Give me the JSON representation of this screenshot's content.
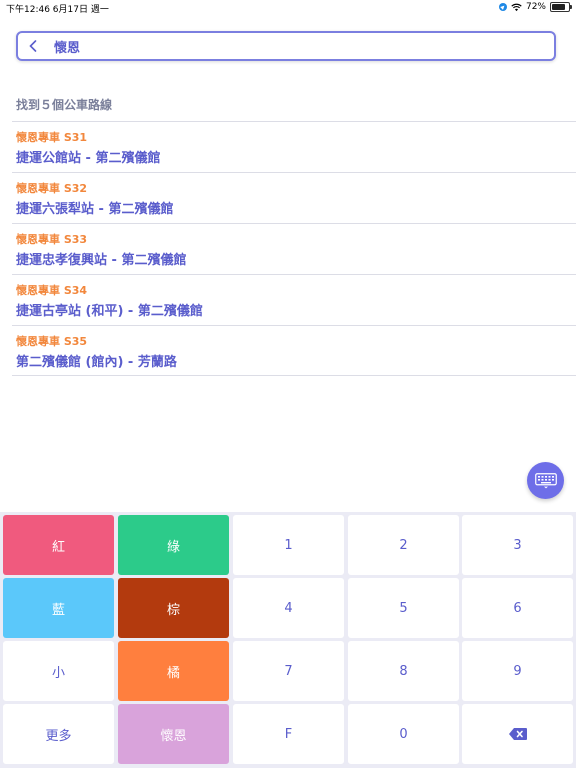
{
  "status_bar": {
    "time_date": "下午12:46  6月17日 週一",
    "battery": "72%",
    "battery_level": 0.72
  },
  "search": {
    "value": "懷恩",
    "placeholder": ""
  },
  "results": {
    "count_text": "找到５個公車路線",
    "routes": [
      {
        "name": "懷恩專車 S31",
        "desc": "捷運公館站 - 第二殯儀館"
      },
      {
        "name": "懷恩專車 S32",
        "desc": "捷運六張犁站 - 第二殯儀館"
      },
      {
        "name": "懷恩專車 S33",
        "desc": "捷運忠孝復興站 - 第二殯儀館"
      },
      {
        "name": "懷恩專車 S34",
        "desc": "捷運古亭站 (和平) - 第二殯儀館"
      },
      {
        "name": "懷恩專車 S35",
        "desc": "第二殯儀館 (館內) - 芳蘭路"
      }
    ]
  },
  "colors": {
    "accent": "#5a5dcc",
    "route_name": "#f2873c",
    "red": "#f05a7e",
    "green": "#2ccb8a",
    "blue": "#5bc8fa",
    "brown": "#b33a0e",
    "orange": "#ff7f3e",
    "purple": "#d9a3db"
  },
  "keypad": {
    "red": "紅",
    "green": "綠",
    "one": "1",
    "two": "2",
    "three": "3",
    "blue": "藍",
    "brown": "棕",
    "four": "4",
    "five": "5",
    "six": "6",
    "small": "小",
    "orange": "橘",
    "seven": "7",
    "eight": "8",
    "nine": "9",
    "more": "更多",
    "special": "懷恩",
    "f": "F",
    "zero": "0"
  }
}
